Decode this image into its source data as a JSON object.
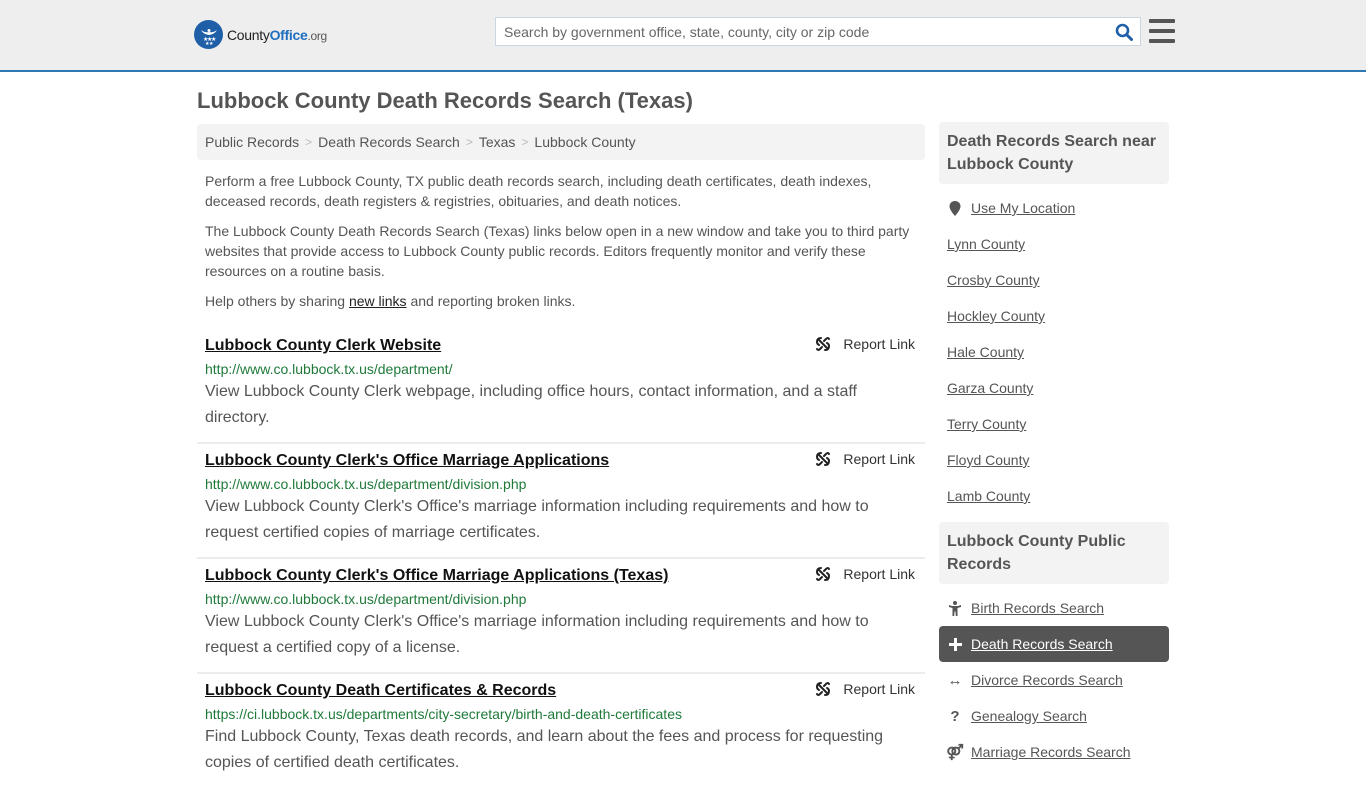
{
  "header": {
    "logo": {
      "part1": "County",
      "part2": "Office",
      "part3": ".org"
    },
    "search": {
      "placeholder": "Search by government office, state, county, city or zip code",
      "value": ""
    },
    "icons": {
      "search": "search-icon",
      "menu": "hamburger-menu-icon"
    }
  },
  "page": {
    "title": "Lubbock County Death Records Search (Texas)"
  },
  "breadcrumb": [
    {
      "label": "Public Records"
    },
    {
      "label": "Death Records Search"
    },
    {
      "label": "Texas"
    },
    {
      "label": "Lubbock County"
    }
  ],
  "intro": {
    "p1": "Perform a free Lubbock County, TX public death records search, including death certificates, death indexes, deceased records, death registers & registries, obituaries, and death notices.",
    "p2": "The Lubbock County Death Records Search (Texas) links below open in a new window and take you to third party websites that provide access to Lubbock County public records. Editors frequently monitor and verify these resources on a routine basis.",
    "p3_before": "Help others by sharing ",
    "p3_link": "new links",
    "p3_after": " and reporting broken links."
  },
  "results": [
    {
      "title": "Lubbock County Clerk Website",
      "url": "http://www.co.lubbock.tx.us/department/",
      "description": "View Lubbock County Clerk webpage, including office hours, contact information, and a staff directory.",
      "report_label": "Report Link"
    },
    {
      "title": "Lubbock County Clerk's Office Marriage Applications",
      "url": "http://www.co.lubbock.tx.us/department/division.php",
      "description": "View Lubbock County Clerk's Office's marriage information including requirements and how to request certified copies of marriage certificates.",
      "report_label": "Report Link"
    },
    {
      "title": "Lubbock County Clerk's Office Marriage Applications (Texas)",
      "url": "http://www.co.lubbock.tx.us/department/division.php",
      "description": "View Lubbock County Clerk's Office's marriage information including requirements and how to request a certified copy of a license.",
      "report_label": "Report Link"
    },
    {
      "title": "Lubbock County Death Certificates & Records",
      "url": "https://ci.lubbock.tx.us/departments/city-secretary/birth-and-death-certificates",
      "description": "Find Lubbock County, Texas death records, and learn about the fees and process for requesting copies of certified death certificates.",
      "report_label": "Report Link"
    }
  ],
  "sidebar": {
    "nearby": {
      "heading": "Death Records Search near Lubbock County",
      "use_location": "Use My Location",
      "counties": [
        "Lynn County",
        "Crosby County",
        "Hockley County",
        "Hale County",
        "Garza County",
        "Terry County",
        "Floyd County",
        "Lamb County"
      ]
    },
    "public_records": {
      "heading": "Lubbock County Public Records",
      "items": [
        {
          "label": "Birth Records Search",
          "icon": "child-icon",
          "active": false
        },
        {
          "label": "Death Records Search",
          "icon": "plus-cross-icon",
          "active": true
        },
        {
          "label": "Divorce Records Search",
          "icon": "arrows-horizontal-icon",
          "active": false
        },
        {
          "label": "Genealogy Search",
          "icon": "question-icon",
          "active": false
        },
        {
          "label": "Marriage Records Search",
          "icon": "marriage-symbol-icon",
          "active": false
        }
      ]
    }
  },
  "colors": {
    "brand_blue": "#1f5fa8",
    "header_border": "#2e78b3",
    "url_green": "#1f7a3a",
    "active_item_bg": "#555555"
  }
}
